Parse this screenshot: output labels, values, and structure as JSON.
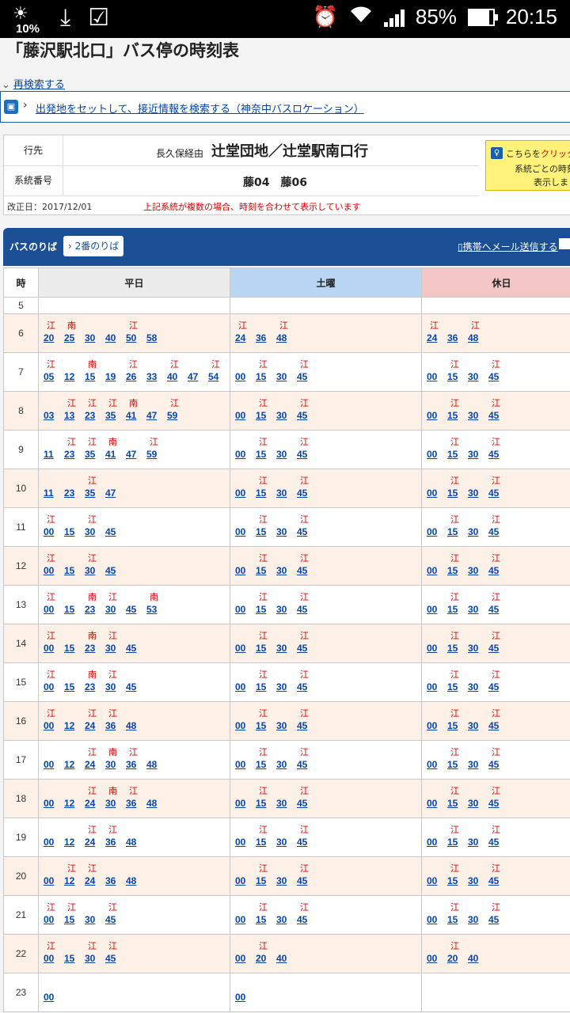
{
  "status_bar": {
    "weather_pct": "10%",
    "battery": "85%",
    "time": "20:15"
  },
  "page": {
    "title": "「藤沢駅北口」バス停の時刻表",
    "research_link": "再検索する",
    "location_link": "出発地をセットして、接近情報を検索する（神奈中バスロケーション）"
  },
  "info": {
    "dest_label": "行先",
    "dest_via": "長久保経由",
    "dest_main": "辻堂団地／辻堂駅南口行",
    "route_label": "系統番号",
    "routes": "藤04　藤06",
    "revision": "改正日：2017/12/01",
    "revision_note": "上記系統が複数の場合、時刻を合わせて表示しています",
    "click_box": {
      "pre": "こちらを",
      "red": "クリック",
      "line2": "系統ごとの時刻",
      "line3": "表示しま"
    }
  },
  "timetable": {
    "noriba_label": "バスのりば",
    "noriba_button": "2番のりば",
    "mail_link": "携帯へメール送信する",
    "headers": {
      "hour": "時",
      "weekday": "平日",
      "saturday": "土曜",
      "holiday": "休日"
    },
    "rows": [
      {
        "hour": "5",
        "weekday": [],
        "saturday": [],
        "holiday": []
      },
      {
        "hour": "6",
        "weekday": [
          [
            "江",
            "20"
          ],
          [
            "南",
            "25"
          ],
          [
            "",
            "30"
          ],
          [
            "",
            "40"
          ],
          [
            "江",
            "50"
          ],
          [
            "",
            "58"
          ]
        ],
        "saturday": [
          [
            "江",
            "24"
          ],
          [
            "",
            "36"
          ],
          [
            "江",
            "48"
          ]
        ],
        "holiday": [
          [
            "江",
            "24"
          ],
          [
            "",
            "36"
          ],
          [
            "江",
            "48"
          ]
        ]
      },
      {
        "hour": "7",
        "weekday": [
          [
            "江",
            "05"
          ],
          [
            "",
            "12"
          ],
          [
            "南",
            "15"
          ],
          [
            "",
            "19"
          ],
          [
            "江",
            "26"
          ],
          [
            "",
            "33"
          ],
          [
            "江",
            "40"
          ],
          [
            "",
            "47"
          ],
          [
            "江",
            "54"
          ]
        ],
        "saturday": [
          [
            "",
            "00"
          ],
          [
            "江",
            "15"
          ],
          [
            "",
            "30"
          ],
          [
            "江",
            "45"
          ]
        ],
        "holiday": [
          [
            "",
            "00"
          ],
          [
            "江",
            "15"
          ],
          [
            "",
            "30"
          ],
          [
            "江",
            "45"
          ]
        ]
      },
      {
        "hour": "8",
        "weekday": [
          [
            "",
            "03"
          ],
          [
            "江",
            "13"
          ],
          [
            "江",
            "23"
          ],
          [
            "江",
            "35"
          ],
          [
            "南",
            "41"
          ],
          [
            "",
            "47"
          ],
          [
            "江",
            "59"
          ]
        ],
        "saturday": [
          [
            "",
            "00"
          ],
          [
            "江",
            "15"
          ],
          [
            "",
            "30"
          ],
          [
            "江",
            "45"
          ]
        ],
        "holiday": [
          [
            "",
            "00"
          ],
          [
            "江",
            "15"
          ],
          [
            "",
            "30"
          ],
          [
            "江",
            "45"
          ]
        ]
      },
      {
        "hour": "9",
        "weekday": [
          [
            "",
            "11"
          ],
          [
            "江",
            "23"
          ],
          [
            "江",
            "35"
          ],
          [
            "南",
            "41"
          ],
          [
            "",
            "47"
          ],
          [
            "江",
            "59"
          ]
        ],
        "saturday": [
          [
            "",
            "00"
          ],
          [
            "江",
            "15"
          ],
          [
            "",
            "30"
          ],
          [
            "江",
            "45"
          ]
        ],
        "holiday": [
          [
            "",
            "00"
          ],
          [
            "江",
            "15"
          ],
          [
            "",
            "30"
          ],
          [
            "江",
            "45"
          ]
        ]
      },
      {
        "hour": "10",
        "weekday": [
          [
            "",
            "11"
          ],
          [
            "",
            "23"
          ],
          [
            "江",
            "35"
          ],
          [
            "",
            "47"
          ]
        ],
        "saturday": [
          [
            "",
            "00"
          ],
          [
            "江",
            "15"
          ],
          [
            "",
            "30"
          ],
          [
            "江",
            "45"
          ]
        ],
        "holiday": [
          [
            "",
            "00"
          ],
          [
            "江",
            "15"
          ],
          [
            "",
            "30"
          ],
          [
            "江",
            "45"
          ]
        ]
      },
      {
        "hour": "11",
        "weekday": [
          [
            "江",
            "00"
          ],
          [
            "",
            "15"
          ],
          [
            "江",
            "30"
          ],
          [
            "",
            "45"
          ]
        ],
        "saturday": [
          [
            "",
            "00"
          ],
          [
            "江",
            "15"
          ],
          [
            "",
            "30"
          ],
          [
            "江",
            "45"
          ]
        ],
        "holiday": [
          [
            "",
            "00"
          ],
          [
            "江",
            "15"
          ],
          [
            "",
            "30"
          ],
          [
            "江",
            "45"
          ]
        ]
      },
      {
        "hour": "12",
        "weekday": [
          [
            "江",
            "00"
          ],
          [
            "",
            "15"
          ],
          [
            "江",
            "30"
          ],
          [
            "",
            "45"
          ]
        ],
        "saturday": [
          [
            "",
            "00"
          ],
          [
            "江",
            "15"
          ],
          [
            "",
            "30"
          ],
          [
            "江",
            "45"
          ]
        ],
        "holiday": [
          [
            "",
            "00"
          ],
          [
            "江",
            "15"
          ],
          [
            "",
            "30"
          ],
          [
            "江",
            "45"
          ]
        ]
      },
      {
        "hour": "13",
        "weekday": [
          [
            "江",
            "00"
          ],
          [
            "",
            "15"
          ],
          [
            "南",
            "23"
          ],
          [
            "江",
            "30"
          ],
          [
            "",
            "45"
          ],
          [
            "南",
            "53"
          ]
        ],
        "saturday": [
          [
            "",
            "00"
          ],
          [
            "江",
            "15"
          ],
          [
            "",
            "30"
          ],
          [
            "江",
            "45"
          ]
        ],
        "holiday": [
          [
            "",
            "00"
          ],
          [
            "江",
            "15"
          ],
          [
            "",
            "30"
          ],
          [
            "江",
            "45"
          ]
        ]
      },
      {
        "hour": "14",
        "weekday": [
          [
            "江",
            "00"
          ],
          [
            "",
            "15"
          ],
          [
            "南",
            "23"
          ],
          [
            "江",
            "30"
          ],
          [
            "",
            "45"
          ]
        ],
        "saturday": [
          [
            "",
            "00"
          ],
          [
            "江",
            "15"
          ],
          [
            "",
            "30"
          ],
          [
            "江",
            "45"
          ]
        ],
        "holiday": [
          [
            "",
            "00"
          ],
          [
            "江",
            "15"
          ],
          [
            "",
            "30"
          ],
          [
            "江",
            "45"
          ]
        ]
      },
      {
        "hour": "15",
        "weekday": [
          [
            "江",
            "00"
          ],
          [
            "",
            "15"
          ],
          [
            "南",
            "23"
          ],
          [
            "江",
            "30"
          ],
          [
            "",
            "45"
          ]
        ],
        "saturday": [
          [
            "",
            "00"
          ],
          [
            "江",
            "15"
          ],
          [
            "",
            "30"
          ],
          [
            "江",
            "45"
          ]
        ],
        "holiday": [
          [
            "",
            "00"
          ],
          [
            "江",
            "15"
          ],
          [
            "",
            "30"
          ],
          [
            "江",
            "45"
          ]
        ]
      },
      {
        "hour": "16",
        "weekday": [
          [
            "江",
            "00"
          ],
          [
            "",
            "12"
          ],
          [
            "江",
            "24"
          ],
          [
            "江",
            "36"
          ],
          [
            "",
            "48"
          ]
        ],
        "saturday": [
          [
            "",
            "00"
          ],
          [
            "江",
            "15"
          ],
          [
            "",
            "30"
          ],
          [
            "江",
            "45"
          ]
        ],
        "holiday": [
          [
            "",
            "00"
          ],
          [
            "江",
            "15"
          ],
          [
            "",
            "30"
          ],
          [
            "江",
            "45"
          ]
        ]
      },
      {
        "hour": "17",
        "weekday": [
          [
            "",
            "00"
          ],
          [
            "",
            "12"
          ],
          [
            "江",
            "24"
          ],
          [
            "南",
            "30"
          ],
          [
            "江",
            "36"
          ],
          [
            "",
            "48"
          ]
        ],
        "saturday": [
          [
            "",
            "00"
          ],
          [
            "江",
            "15"
          ],
          [
            "",
            "30"
          ],
          [
            "江",
            "45"
          ]
        ],
        "holiday": [
          [
            "",
            "00"
          ],
          [
            "江",
            "15"
          ],
          [
            "",
            "30"
          ],
          [
            "江",
            "45"
          ]
        ]
      },
      {
        "hour": "18",
        "weekday": [
          [
            "",
            "00"
          ],
          [
            "",
            "12"
          ],
          [
            "江",
            "24"
          ],
          [
            "南",
            "30"
          ],
          [
            "江",
            "36"
          ],
          [
            "",
            "48"
          ]
        ],
        "saturday": [
          [
            "",
            "00"
          ],
          [
            "江",
            "15"
          ],
          [
            "",
            "30"
          ],
          [
            "江",
            "45"
          ]
        ],
        "holiday": [
          [
            "",
            "00"
          ],
          [
            "江",
            "15"
          ],
          [
            "",
            "30"
          ],
          [
            "江",
            "45"
          ]
        ]
      },
      {
        "hour": "19",
        "weekday": [
          [
            "",
            "00"
          ],
          [
            "",
            "12"
          ],
          [
            "江",
            "24"
          ],
          [
            "江",
            "36"
          ],
          [
            "",
            "48"
          ]
        ],
        "saturday": [
          [
            "",
            "00"
          ],
          [
            "江",
            "15"
          ],
          [
            "",
            "30"
          ],
          [
            "江",
            "45"
          ]
        ],
        "holiday": [
          [
            "",
            "00"
          ],
          [
            "江",
            "15"
          ],
          [
            "",
            "30"
          ],
          [
            "江",
            "45"
          ]
        ]
      },
      {
        "hour": "20",
        "weekday": [
          [
            "",
            "00"
          ],
          [
            "江",
            "12"
          ],
          [
            "江",
            "24"
          ],
          [
            "",
            "36"
          ],
          [
            "",
            "48"
          ]
        ],
        "saturday": [
          [
            "",
            "00"
          ],
          [
            "江",
            "15"
          ],
          [
            "",
            "30"
          ],
          [
            "江",
            "45"
          ]
        ],
        "holiday": [
          [
            "",
            "00"
          ],
          [
            "江",
            "15"
          ],
          [
            "",
            "30"
          ],
          [
            "江",
            "45"
          ]
        ]
      },
      {
        "hour": "21",
        "weekday": [
          [
            "江",
            "00"
          ],
          [
            "江",
            "15"
          ],
          [
            "",
            "30"
          ],
          [
            "江",
            "45"
          ]
        ],
        "saturday": [
          [
            "",
            "00"
          ],
          [
            "江",
            "15"
          ],
          [
            "",
            "30"
          ],
          [
            "江",
            "45"
          ]
        ],
        "holiday": [
          [
            "",
            "00"
          ],
          [
            "江",
            "15"
          ],
          [
            "",
            "30"
          ],
          [
            "江",
            "45"
          ]
        ]
      },
      {
        "hour": "22",
        "weekday": [
          [
            "江",
            "00"
          ],
          [
            "",
            "15"
          ],
          [
            "江",
            "30"
          ],
          [
            "江",
            "45"
          ]
        ],
        "saturday": [
          [
            "",
            "00"
          ],
          [
            "江",
            "20"
          ],
          [
            "",
            "40"
          ]
        ],
        "holiday": [
          [
            "",
            "00"
          ],
          [
            "江",
            "20"
          ],
          [
            "",
            "40"
          ]
        ]
      },
      {
        "hour": "23",
        "weekday": [
          [
            "",
            "00"
          ]
        ],
        "saturday": [
          [
            "",
            "00"
          ]
        ],
        "holiday": []
      }
    ]
  },
  "colors": {
    "header_blue": "#1a4f96",
    "link": "#0645ad",
    "mark_red": "#dd0000",
    "row_cream": "#fdf0e6",
    "saturday": "#b9d5f2",
    "holiday": "#f5c6c6"
  }
}
